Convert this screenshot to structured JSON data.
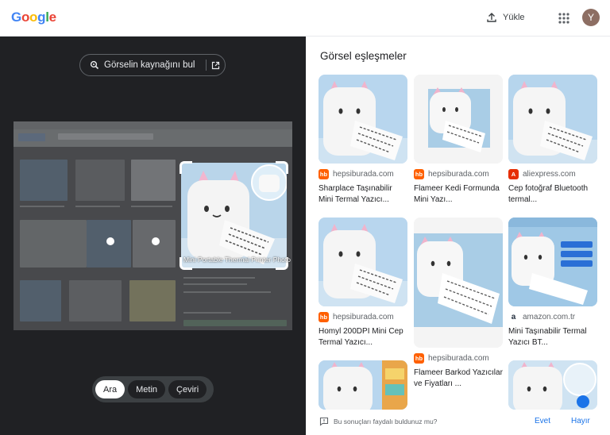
{
  "header": {
    "logo_letters": [
      {
        "ch": "G",
        "color": "#4285F4"
      },
      {
        "ch": "o",
        "color": "#EA4335"
      },
      {
        "ch": "o",
        "color": "#FBBC05"
      },
      {
        "ch": "g",
        "color": "#4285F4"
      },
      {
        "ch": "l",
        "color": "#34A853"
      },
      {
        "ch": "e",
        "color": "#EA4335"
      }
    ],
    "upload_label": "Yükle",
    "upload_icon": "upload-icon",
    "apps_icon": "apps-grid-icon",
    "avatar_initial": "Y"
  },
  "left_panel": {
    "find_source_label": "Görselin kaynağını bul",
    "find_source_icon": "lens-icon",
    "open_external_icon": "open-in-new-icon",
    "crop_caption": "Mini Portable Thermal Printer Photo",
    "modes": [
      {
        "label": "Ara",
        "active": true
      },
      {
        "label": "Metin",
        "active": false
      },
      {
        "label": "Çeviri",
        "active": false
      }
    ]
  },
  "right_panel": {
    "heading": "Görsel eşleşmeler",
    "results": [
      {
        "source": "hepsiburada.com",
        "favicon": "hb",
        "favicon_color": "#ff6000",
        "title": "Sharplace Taşınabilir Mini Termal Yazıcı..."
      },
      {
        "source": "hepsiburada.com",
        "favicon": "hb",
        "favicon_color": "#ff6000",
        "title": "Flameer Kedi Formunda Mini Yazı..."
      },
      {
        "source": "aliexpress.com",
        "favicon": "A",
        "favicon_color": "#e62e04",
        "title": "Cep fotoğraf Bluetooth termal..."
      },
      {
        "source": "hepsiburada.com",
        "favicon": "hb",
        "favicon_color": "#ff6000",
        "title": "Homyl 200DPI Mini Cep Termal Yazıcı..."
      },
      {
        "source": "hepsiburada.com",
        "favicon": "hb",
        "favicon_color": "#ff6000",
        "title": "Flameer Barkod Yazıcılar ve Fiyatları ..."
      },
      {
        "source": "amazon.com.tr",
        "favicon": "a",
        "favicon_color": "#232f3e",
        "title": "Mini Taşınabilir Termal Yazıcı BT..."
      }
    ],
    "feedback_question": "Bu sonuçları faydalı buldunuz mu?",
    "feedback_icon": "feedback-icon",
    "yes_label": "Evet",
    "no_label": "Hayır"
  }
}
